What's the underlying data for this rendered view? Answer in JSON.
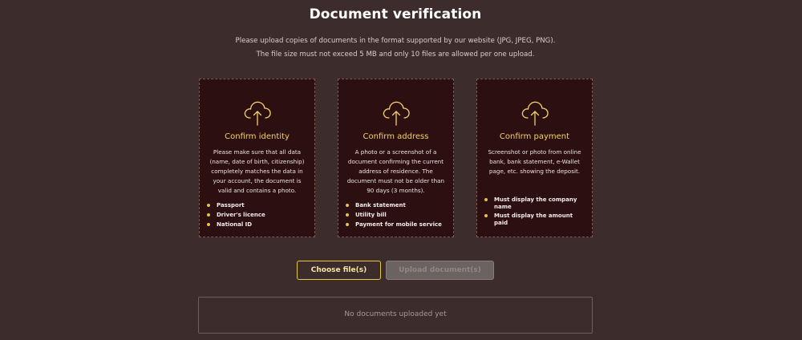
{
  "header": {
    "title": "Document verification",
    "subtitle_line1": "Please upload copies of documents in the format supported by our website (JPG, JPEG, PNG).",
    "subtitle_line2": "The file size must not exceed 5 MB and only 10 files are allowed per one upload."
  },
  "cards": [
    {
      "icon": "cloud-upload-icon",
      "title": "Confirm identity",
      "description": "Please make sure that all data (name, date of birth, citizenship) completely matches the data in your account, the document is valid and contains a photo.",
      "items": [
        "Passport",
        "Driver's licence",
        "National ID"
      ]
    },
    {
      "icon": "cloud-upload-icon",
      "title": "Confirm address",
      "description": "A photo or a screenshot of a document confirming the current address of residence. The document must not be older than 90 days (3 months).",
      "items": [
        "Bank statement",
        "Utility bill",
        "Payment for mobile service"
      ]
    },
    {
      "icon": "cloud-upload-icon",
      "title": "Confirm payment",
      "description": "Screenshot or photo from online bank, bank statement, e-Wallet page, etc. showing the deposit.",
      "items": [
        "Must display the company name",
        "Must display the amount paid"
      ]
    }
  ],
  "actions": {
    "choose_label": "Choose file(s)",
    "upload_label": "Upload document(s)",
    "upload_disabled": true
  },
  "uploads": {
    "empty_text": "No documents uploaded yet"
  },
  "colors": {
    "background": "#3d2c2c",
    "card_background": "#2c0f10",
    "accent": "#f1d36a"
  }
}
